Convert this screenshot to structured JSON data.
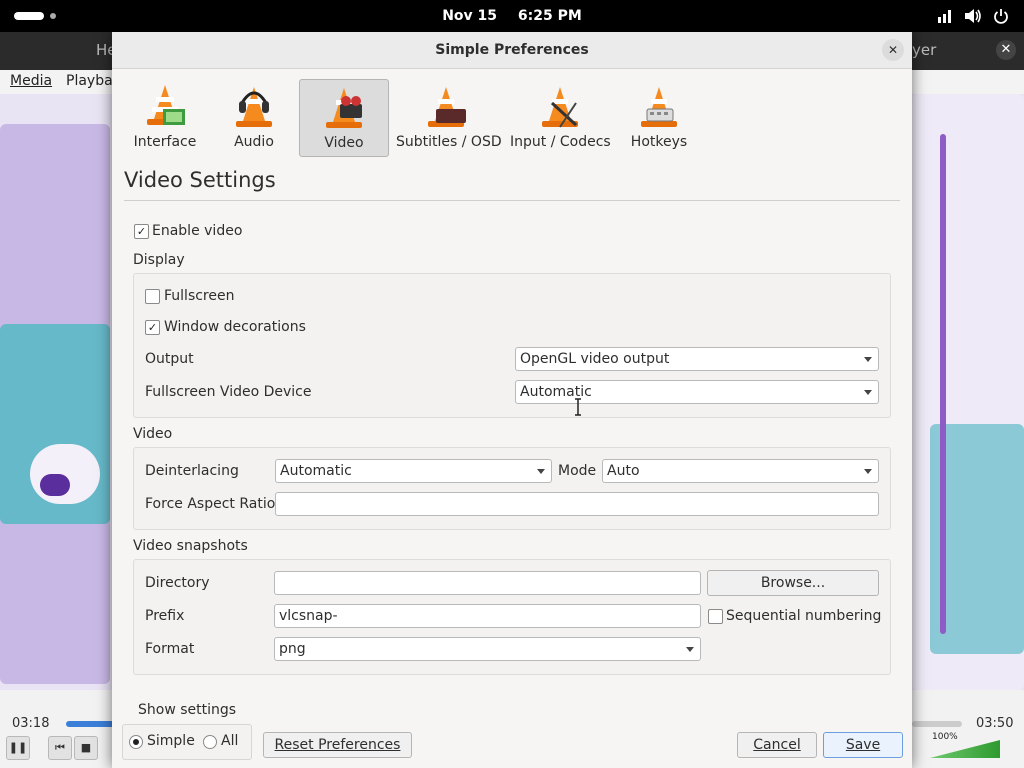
{
  "topbar": {
    "date": "Nov 15",
    "time": "6:25 PM"
  },
  "vlc": {
    "title_left": "He",
    "title_right": "yer",
    "menu": [
      "Media",
      "Playback"
    ],
    "elapsed": "03:18",
    "total": "03:50",
    "volume": "100%"
  },
  "dialog": {
    "title": "Simple Preferences",
    "categories": [
      {
        "label": "Interface"
      },
      {
        "label": "Audio"
      },
      {
        "label": "Video"
      },
      {
        "label": "Subtitles / OSD"
      },
      {
        "label": "Input / Codecs"
      },
      {
        "label": "Hotkeys"
      }
    ],
    "active_category": "Video",
    "settings_title": "Video Settings",
    "enable_video": {
      "label": "Enable video",
      "checked": true
    },
    "display": {
      "header": "Display",
      "fullscreen": {
        "label": "Fullscreen",
        "checked": false
      },
      "window_decorations": {
        "label": "Window decorations",
        "checked": true
      },
      "output_label": "Output",
      "output_value": "OpenGL video output",
      "fs_device_label": "Fullscreen Video Device",
      "fs_device_value": "Automatic"
    },
    "video": {
      "header": "Video",
      "deinterlacing_label": "Deinterlacing",
      "deinterlacing_value": "Automatic",
      "mode_label": "Mode",
      "mode_value": "Auto",
      "aspect_label": "Force Aspect Ratio",
      "aspect_value": ""
    },
    "snapshots": {
      "header": "Video snapshots",
      "directory_label": "Directory",
      "directory_value": "",
      "browse_label": "Browse...",
      "prefix_label": "Prefix",
      "prefix_value": "vlcsnap-",
      "sequential": {
        "label": "Sequential numbering",
        "checked": false
      },
      "format_label": "Format",
      "format_value": "png"
    },
    "show_settings": {
      "label": "Show settings",
      "simple": "Simple",
      "all": "All",
      "selected": "Simple"
    },
    "buttons": {
      "reset": "Reset Preferences",
      "cancel": "Cancel",
      "save": "Save"
    }
  }
}
